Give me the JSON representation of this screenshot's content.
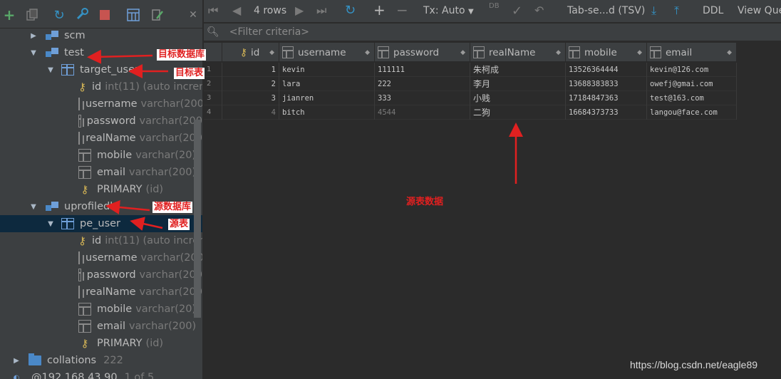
{
  "left_toolbar": {
    "add_icon": "plus-icon",
    "copy_icon": "copy-icon",
    "refresh_icon": "refresh-icon",
    "tools_icon": "wrench-icon",
    "stop_icon": "stop-icon",
    "table_icon": "table-icon",
    "edit_icon": "edit-icon",
    "close_icon": "close-icon"
  },
  "tree": {
    "scm": "scm",
    "test": "test",
    "target_user": "target_user",
    "target_columns": [
      {
        "name": "id",
        "type": "int(11) (auto increm"
      },
      {
        "name": "username",
        "type": "varchar(200"
      },
      {
        "name": "password",
        "type": "varchar(200"
      },
      {
        "name": "realName",
        "type": "varchar(200"
      },
      {
        "name": "mobile",
        "type": "varchar(20)"
      },
      {
        "name": "email",
        "type": "varchar(200)"
      }
    ],
    "target_primary": {
      "name": "PRIMARY",
      "type": "(id)"
    },
    "uprofiledb": "uprofiledb",
    "pe_user": "pe_user",
    "pe_columns": [
      {
        "name": "id",
        "type": "int(11) (auto increm"
      },
      {
        "name": "username",
        "type": "varchar(200"
      },
      {
        "name": "password",
        "type": "varchar(200"
      },
      {
        "name": "realName",
        "type": "varchar(200"
      },
      {
        "name": "mobile",
        "type": "varchar(20)"
      },
      {
        "name": "email",
        "type": "varchar(200)"
      }
    ],
    "pe_primary": {
      "name": "PRIMARY",
      "type": "(id)"
    },
    "collations": "collations",
    "collations_count": "222",
    "host": "@192.168.43.90",
    "host_info": "1 of 5"
  },
  "right_toolbar": {
    "rows": "4 rows",
    "tx": "Tx: Auto",
    "format": "Tab-se...d (TSV)",
    "ddl": "DDL",
    "view_query": "View Que"
  },
  "filter": {
    "placeholder": "<Filter criteria>"
  },
  "grid": {
    "headers": [
      "id",
      "username",
      "password",
      "realName",
      "mobile",
      "email"
    ],
    "rows": [
      {
        "rownum": "1",
        "id": "1",
        "username": "kevin",
        "password": "111111",
        "realName": "朱柯成",
        "mobile": "13526364444",
        "email": "kevin@126.com"
      },
      {
        "rownum": "2",
        "id": "2",
        "username": "lara",
        "password": "222",
        "realName": "李月",
        "mobile": "13688383833",
        "email": "owefj@gmai.com"
      },
      {
        "rownum": "3",
        "id": "3",
        "username": "jianren",
        "password": "333",
        "realName": "小贱",
        "mobile": "17184847363",
        "email": "test@163.com"
      },
      {
        "rownum": "4",
        "id": "4",
        "username": "bitch",
        "password": "4544",
        "realName": "二狗",
        "mobile": "16684373733",
        "email": "langou@face.com"
      }
    ]
  },
  "annotations": {
    "target_db": "目标数据库",
    "target_table": "目标表",
    "source_db": "源数据库",
    "source_table": "源表",
    "source_data": "源表数据"
  },
  "watermark": "https://blog.csdn.net/eagle89",
  "colors": {
    "annotation": "#e02020",
    "selection": "#0d293e",
    "accent": "#4a88c7"
  }
}
